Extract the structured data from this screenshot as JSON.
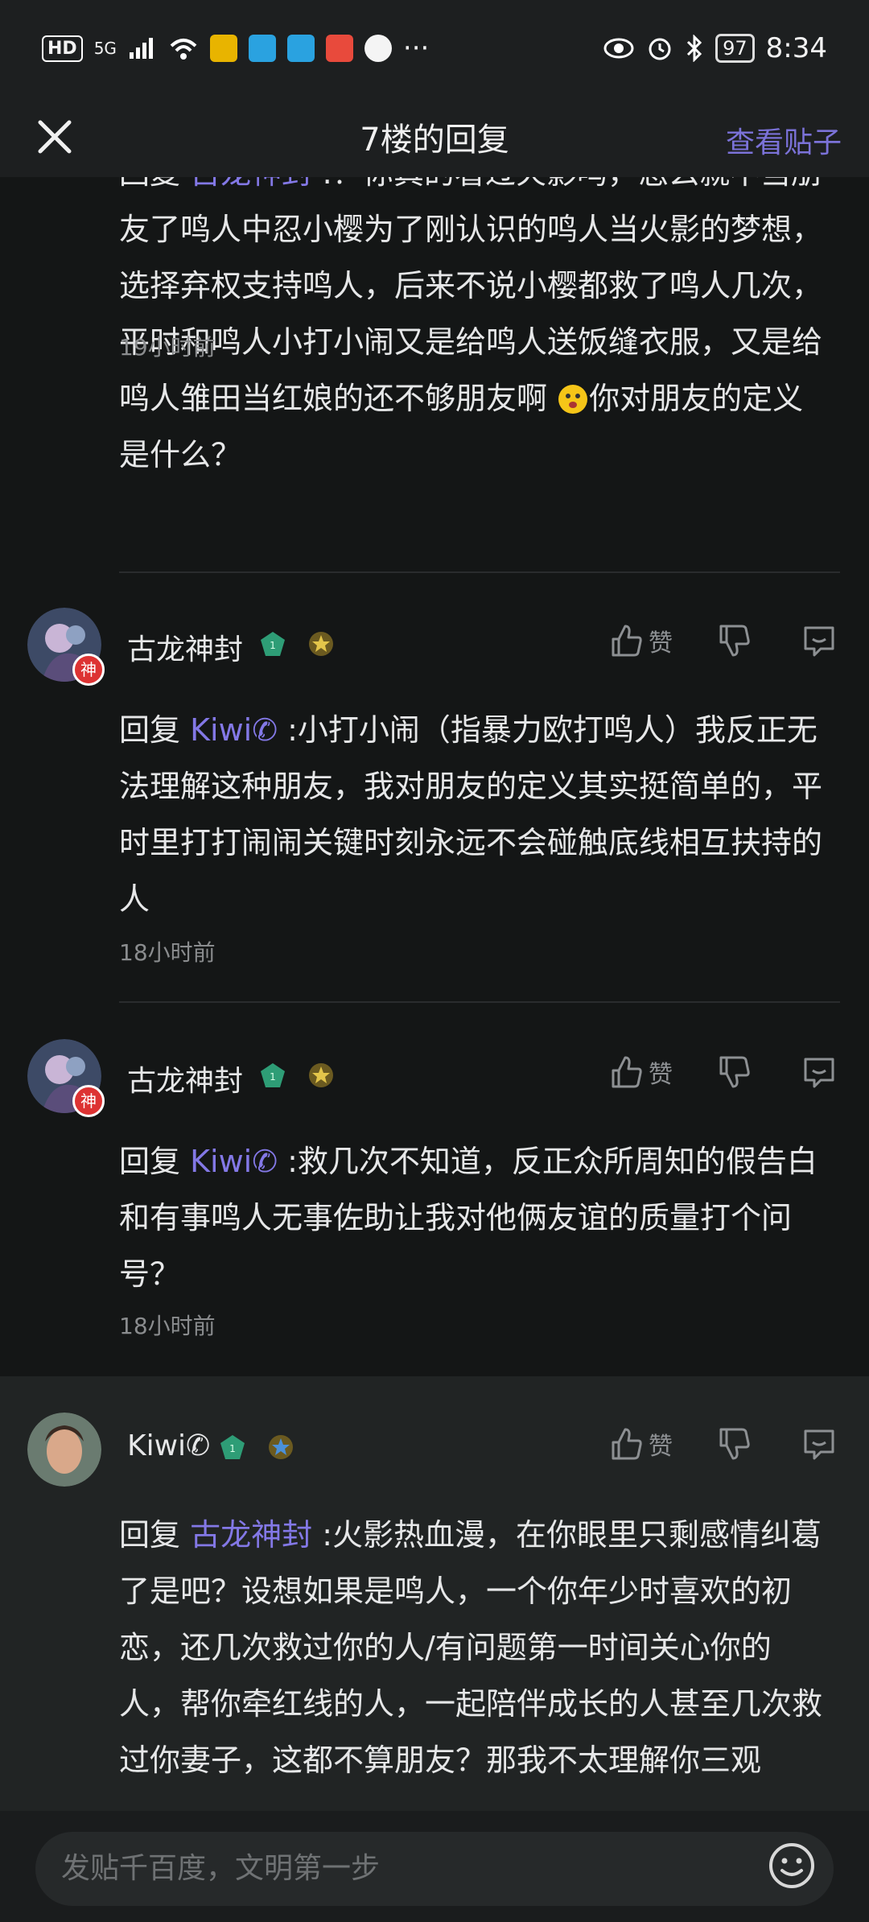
{
  "status": {
    "hd": "HD",
    "network": "5G",
    "time": "8:34",
    "battery": "97",
    "more": "···"
  },
  "titlebar": {
    "title": "7楼的回复",
    "view_post": "查看贴子"
  },
  "replies": [
    {
      "text_prefix": "回复 ",
      "mention": "古龙神封",
      "text": " :？你真的看过火影吗，怎么就不当朋友了鸣人中忍小樱为了刚认识的鸣人当火影的梦想，选择弃权支持鸣人，后来不说小樱都救了鸣人几次，平时和鸣人小打小闹又是给鸣人送饭缝衣服，又是给鸣人雏田当红娘的还不够朋友啊 ",
      "text_after_emoji": "你对朋友的定义是什么？",
      "time": "19小时前"
    },
    {
      "name": "古龙神封",
      "level": "1",
      "badge": "神",
      "like_label": "赞",
      "text_prefix": "回复 ",
      "mention": "Kiwi✆",
      "text": " :小打小闹（指暴力欧打鸣人）我反正无法理解这种朋友，我对朋友的定义其实挺简单的，平时里打打闹闹关键时刻永远不会碰触底线相互扶持的人",
      "time": "18小时前"
    },
    {
      "name": "古龙神封",
      "level": "1",
      "badge": "神",
      "like_label": "赞",
      "text_prefix": "回复 ",
      "mention": "Kiwi✆",
      "text": " :救几次不知道，反正众所周知的假告白和有事鸣人无事佐助让我对他俩友谊的质量打个问号？",
      "time": "18小时前"
    },
    {
      "name": "Kiwi✆",
      "level": "1",
      "like_label": "赞",
      "text_prefix": "回复 ",
      "mention": "古龙神封",
      "text": " :火影热血漫，在你眼里只剩感情纠葛了是吧？设想如果是鸣人，一个你年少时喜欢的初恋，还几次救过你的人/有问题第一时间关心你的人，帮你牵红线的人，一起陪伴成长的人甚至几次救过你妻子，这都不算朋友？那我不太理解你三观"
    }
  ],
  "composer": {
    "placeholder": "发贴千百度，文明第一步"
  },
  "colors": {
    "accent": "#7b72d8",
    "background": "#141616",
    "highlight": "#212424"
  }
}
